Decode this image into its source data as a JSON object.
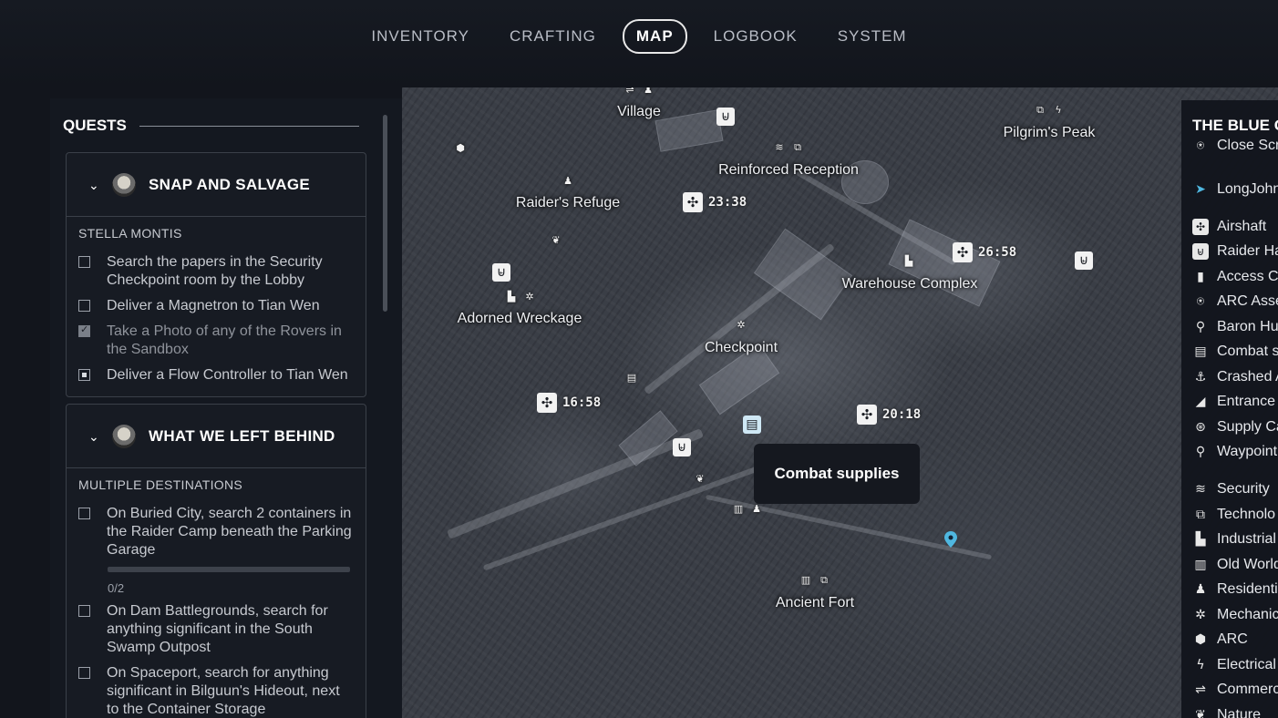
{
  "nav": {
    "tabs": [
      {
        "label": "INVENTORY"
      },
      {
        "label": "CRAFTING"
      },
      {
        "label": "MAP",
        "active": true
      },
      {
        "label": "LOGBOOK"
      },
      {
        "label": "SYSTEM"
      }
    ]
  },
  "quests": {
    "heading": "QUESTS",
    "cards": [
      {
        "title": "SNAP AND SALVAGE",
        "destination": "STELLA MONTIS",
        "tasks": [
          {
            "text": "Search the papers in the Security Checkpoint room by the Lobby",
            "state": "unchecked"
          },
          {
            "text": "Deliver a Magnetron to Tian Wen",
            "state": "unchecked"
          },
          {
            "text": "Take a Photo of any of the Rovers in the Sandbox",
            "state": "checked"
          },
          {
            "text": "Deliver a Flow Controller to Tian Wen",
            "state": "partial"
          }
        ]
      },
      {
        "title": "WHAT WE LEFT BEHIND",
        "destination": "MULTIPLE DESTINATIONS",
        "tasks": [
          {
            "text": "On Buried City, search 2 containers in the Raider Camp beneath the Parking Garage",
            "state": "unchecked",
            "progress_label": "0/2",
            "progress": 0
          },
          {
            "text": "On Dam Battlegrounds, search for anything significant in the South Swamp Outpost",
            "state": "unchecked"
          },
          {
            "text": "On Spaceport, search for anything significant in Bilguun's Hideout, next to the Container Storage",
            "state": "unchecked"
          }
        ]
      }
    ]
  },
  "map": {
    "locations": [
      "Village",
      "Pilgrim's Peak",
      "Reinforced Reception",
      "Raider's Refuge",
      "Warehouse Complex",
      "Adorned Wreckage",
      "Checkpoint",
      "Ancient Fort"
    ],
    "timers": [
      "23:38",
      "26:58",
      "16:58",
      "20:18"
    ],
    "tooltip": "Combat supplies"
  },
  "legend": {
    "title": "THE BLUE G",
    "items": [
      {
        "label": "Close Scr",
        "icon": "close-scrappy-icon"
      },
      {
        "label": "LongJohn",
        "icon": "cursor-icon"
      },
      {
        "label": "Airshaft",
        "icon": "fan-icon"
      },
      {
        "label": "Raider Ha",
        "icon": "raider-hatch-icon"
      },
      {
        "label": "Access Ca",
        "icon": "access-card-icon"
      },
      {
        "label": "ARC Asse",
        "icon": "arc-asset-icon"
      },
      {
        "label": "Baron Hus",
        "icon": "pin-icon"
      },
      {
        "label": "Combat s",
        "icon": "crate-icon"
      },
      {
        "label": "Crashed A",
        "icon": "crashed-icon"
      },
      {
        "label": "Entrance",
        "icon": "entrance-icon"
      },
      {
        "label": "Supply Ca",
        "icon": "supply-icon"
      },
      {
        "label": "Waypoint",
        "icon": "waypoint-icon"
      },
      {
        "label": "Security",
        "icon": "security-icon"
      },
      {
        "label": "Technolo",
        "icon": "technology-icon"
      },
      {
        "label": "Industrial",
        "icon": "industrial-icon"
      },
      {
        "label": "Old World",
        "icon": "old-world-icon"
      },
      {
        "label": "Residenti",
        "icon": "residential-icon"
      },
      {
        "label": "Mechanic",
        "icon": "gear-icon"
      },
      {
        "label": "ARC",
        "icon": "arc-icon"
      },
      {
        "label": "Electrical",
        "icon": "lightning-icon"
      },
      {
        "label": "Commerc",
        "icon": "commercial-icon"
      },
      {
        "label": "Nature",
        "icon": "leaf-icon"
      }
    ]
  }
}
